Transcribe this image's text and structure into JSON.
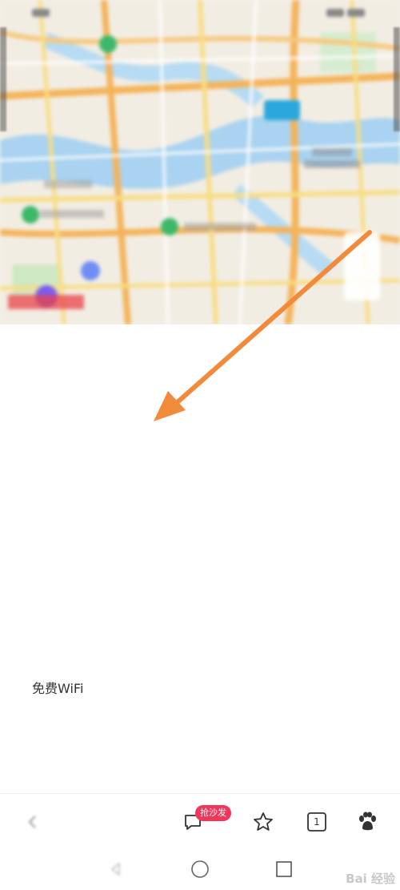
{
  "map": {
    "icons": [
      "map-pin-icon",
      "location-icon",
      "layers-icon"
    ]
  },
  "place": {
    "title": "",
    "subtitle": "",
    "address_label": "",
    "address_value": "",
    "phone_label": "",
    "phone_value": "",
    "hours_label": "",
    "hours_value": "",
    "services_label": "",
    "services_line1": "",
    "services_line2_prefix": "",
    "services_line2_visible": "免费WiFi",
    "payment_label": ""
  },
  "toolbar": {
    "badge_text": "抢沙发",
    "tab_count": "1",
    "icons": [
      "back-icon",
      "comment-icon",
      "star-icon",
      "tabs-icon",
      "paw-icon"
    ]
  },
  "navbar": {
    "icons": [
      "nav-back-icon",
      "nav-home-icon",
      "nav-recent-icon"
    ]
  },
  "watermark": "Bai 经验",
  "colors": {
    "accent": "#f0365a",
    "arrow": "#f28a3c",
    "phone": "#e84040"
  }
}
